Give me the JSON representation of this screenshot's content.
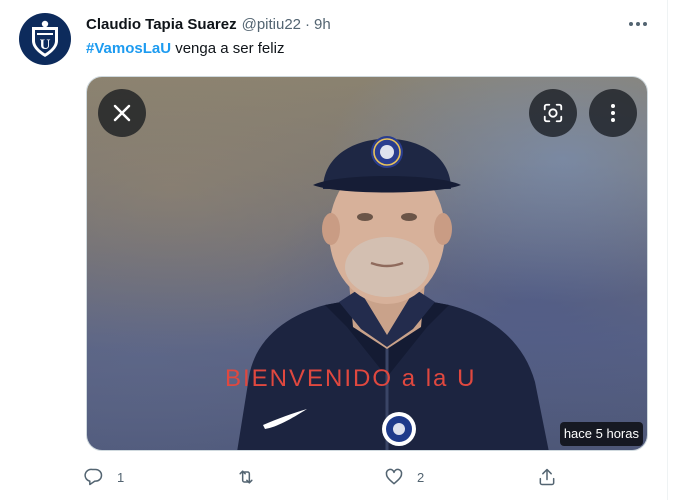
{
  "tweet": {
    "author_name": "Claudio Tapia Suarez",
    "handle": "@pitiu22",
    "separator": "·",
    "time": "9h",
    "hashtag": "#VamosLaU",
    "text": " venga a ser feliz"
  },
  "media": {
    "caption": "BIENVENIDO a la U",
    "timestamp_badge": "hace 5 horas"
  },
  "actions": {
    "reply_count": "1",
    "retweet_count": "",
    "like_count": "2"
  },
  "colors": {
    "accent": "#1d9bf0",
    "secondary_text": "#536471",
    "caption": "#e0483f",
    "avatar_bg": "#0d2b5c"
  },
  "icons": [
    "club-crest-icon",
    "more-icon",
    "close-icon",
    "lens-icon",
    "reply-icon",
    "retweet-icon",
    "like-icon",
    "share-icon"
  ]
}
